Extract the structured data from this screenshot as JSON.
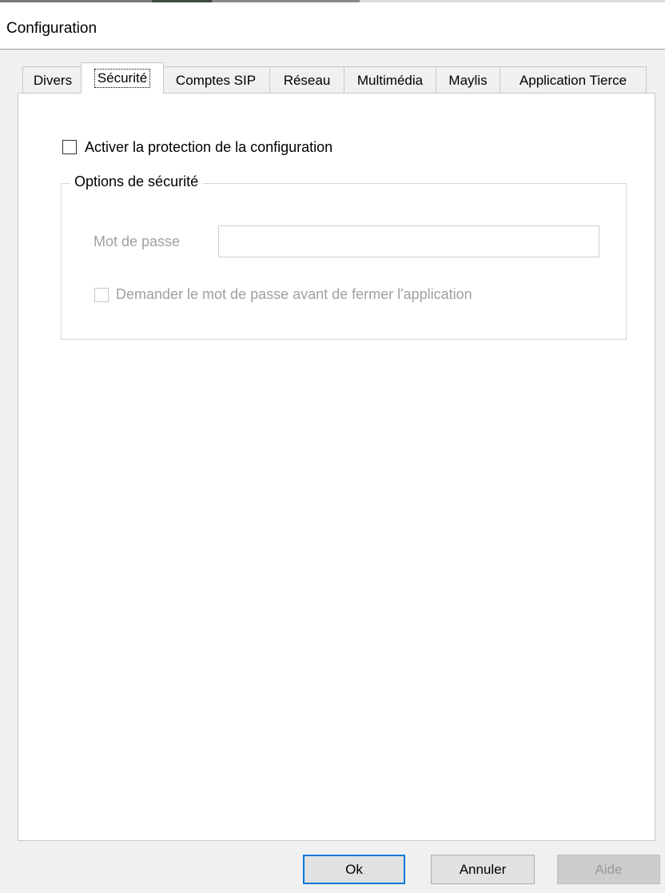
{
  "window": {
    "title": "Configuration"
  },
  "tabs": [
    {
      "label": "Divers",
      "active": false
    },
    {
      "label": "Sécurité",
      "active": true
    },
    {
      "label": "Comptes SIP",
      "active": false
    },
    {
      "label": "Réseau",
      "active": false
    },
    {
      "label": "Multimédia",
      "active": false
    },
    {
      "label": "Maylis",
      "active": false
    },
    {
      "label": "Application Tierce",
      "active": false
    }
  ],
  "security": {
    "enable_protection": {
      "label": "Activer la protection de la configuration",
      "checked": false
    },
    "group": {
      "legend": "Options de sécurité",
      "password_label": "Mot de passe",
      "password_value": "",
      "ask_password": {
        "label": "Demander le mot de passe avant de fermer l'application",
        "checked": false,
        "enabled": false
      }
    }
  },
  "buttons": {
    "ok": "Ok",
    "cancel": "Annuler",
    "help": "Aide"
  },
  "colors": {
    "default_button_border": "#0078d7",
    "panel_background": "#ffffff",
    "window_background": "#f0f0f0",
    "disabled_text": "#a0a0a0"
  }
}
